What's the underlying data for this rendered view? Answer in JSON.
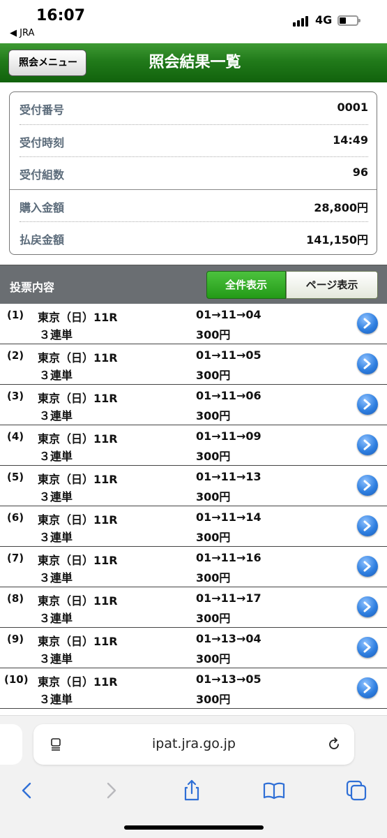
{
  "status_bar": {
    "time": "16:07",
    "back_app": "◀ JRA",
    "network": "4G"
  },
  "header": {
    "menu_button": "照会メニュー",
    "title": "照会結果一覧"
  },
  "summary": {
    "rows": [
      {
        "label": "受付番号",
        "value": "0001"
      },
      {
        "label": "受付時刻",
        "value": "14:49"
      },
      {
        "label": "受付組数",
        "value": "96"
      },
      {
        "label": "購入金額",
        "value": "28,800円"
      },
      {
        "label": "払戻金額",
        "value": "141,150円"
      }
    ]
  },
  "vote_header": {
    "title": "投票内容",
    "btn_all": "全件表示",
    "btn_page": "ページ表示"
  },
  "bets": [
    {
      "no": "(1)",
      "race": "東京（日）11R",
      "type": "３連単",
      "combo": "01→11→04",
      "amount": "300円"
    },
    {
      "no": "(2)",
      "race": "東京（日）11R",
      "type": "３連単",
      "combo": "01→11→05",
      "amount": "300円"
    },
    {
      "no": "(3)",
      "race": "東京（日）11R",
      "type": "３連単",
      "combo": "01→11→06",
      "amount": "300円"
    },
    {
      "no": "(4)",
      "race": "東京（日）11R",
      "type": "３連単",
      "combo": "01→11→09",
      "amount": "300円"
    },
    {
      "no": "(5)",
      "race": "東京（日）11R",
      "type": "３連単",
      "combo": "01→11→13",
      "amount": "300円"
    },
    {
      "no": "(6)",
      "race": "東京（日）11R",
      "type": "３連単",
      "combo": "01→11→14",
      "amount": "300円"
    },
    {
      "no": "(7)",
      "race": "東京（日）11R",
      "type": "３連単",
      "combo": "01→11→16",
      "amount": "300円"
    },
    {
      "no": "(8)",
      "race": "東京（日）11R",
      "type": "３連単",
      "combo": "01→11→17",
      "amount": "300円"
    },
    {
      "no": "(9)",
      "race": "東京（日）11R",
      "type": "３連単",
      "combo": "01→13→04",
      "amount": "300円"
    },
    {
      "no": "(10)",
      "race": "東京（日）11R",
      "type": "３連単",
      "combo": "01→13→05",
      "amount": "300円"
    }
  ],
  "browser": {
    "url": "ipat.jra.go.jp"
  },
  "icons": {
    "row_action": "chevron-right-circle-icon",
    "toolbar": [
      "back-icon",
      "forward-icon",
      "share-icon",
      "bookmarks-icon",
      "tabs-icon"
    ]
  },
  "colors": {
    "header_green": "#217a1a",
    "button_green": "#239a17",
    "link_blue": "#2f7fe0"
  }
}
